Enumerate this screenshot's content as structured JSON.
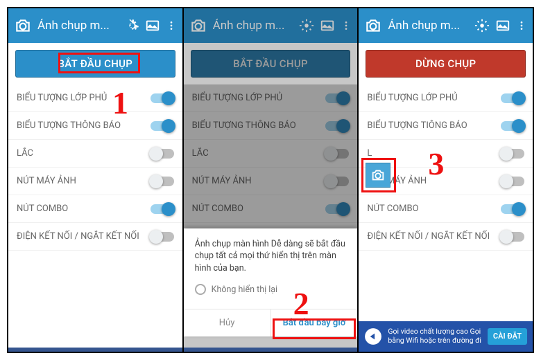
{
  "app_title": "Ảnh chụp m...",
  "steps": {
    "one": "1",
    "two": "2",
    "three": "3"
  },
  "btn": {
    "start": "BẮT ĐẦU CHỤP",
    "stop": "DỪNG CHỤP"
  },
  "rows": {
    "overlay": "BIỂU TƯỢNG LỚP PHỦ",
    "notif": "BIỂU TƯỢNG THÔNG BÁO",
    "notif3": "BIỂU TƯỢNG TIÔNG BÁO",
    "lac": "LẮC",
    "lac3": "L",
    "cambtn": "NÚT MÁY ẢNH",
    "combo": "NÚT COMBO",
    "conn": "ĐIỆN KẾT NỐI / NGẮT KẾT NỐI"
  },
  "dialog": {
    "msg": "Ảnh chụp màn hình Dễ dàng sẽ bắt đầu chụp tất cả mọi thứ hiển thị trên màn hình của bạn.",
    "dont_show": "Không hiển thị lại",
    "cancel": "Hủy",
    "start_now": "Bắt đầu bây giờ"
  },
  "banner": {
    "text": "Gọi video chất lượng cao Gọi bằng Wifi hoặc trên đường đi",
    "install": "CÀI ĐẶT"
  }
}
